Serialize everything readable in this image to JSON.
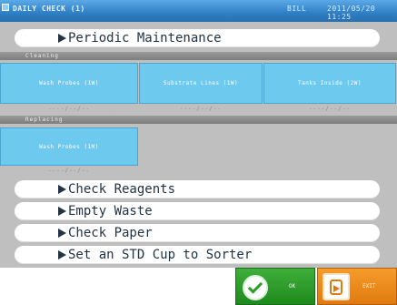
{
  "titlebar": {
    "title": "DAILY CHECK (1)",
    "status": "BILL",
    "datetime": "2011/05/20 11:25"
  },
  "menu": {
    "periodic_maintenance": "Periodic Maintenance",
    "check_reagents": "Check Reagents",
    "empty_waste": "Empty Waste",
    "check_paper": "Check Paper",
    "set_std_cup": "Set an STD Cup to Sorter"
  },
  "cleaning": {
    "header": "Cleaning",
    "items": [
      {
        "label": "Wash Probes (1W)",
        "date": "----/--/--"
      },
      {
        "label": "Substrate Lines (1W)",
        "date": "----/--/--"
      },
      {
        "label": "Tanks Inside (2W)",
        "date": "----/--/--"
      }
    ]
  },
  "replacing": {
    "header": "Replacing",
    "items": [
      {
        "label": "Wash Probes (1M)",
        "date": "----/--/--"
      }
    ]
  },
  "buttons": {
    "ok_label": "OK",
    "exit_label": "EXIT"
  },
  "colors": {
    "titlebar": "#2f7fc4",
    "panel": "#bfbfbf",
    "tile": "#6ec9ef",
    "ok": "#1f8a1d",
    "exit": "#e07a10"
  }
}
